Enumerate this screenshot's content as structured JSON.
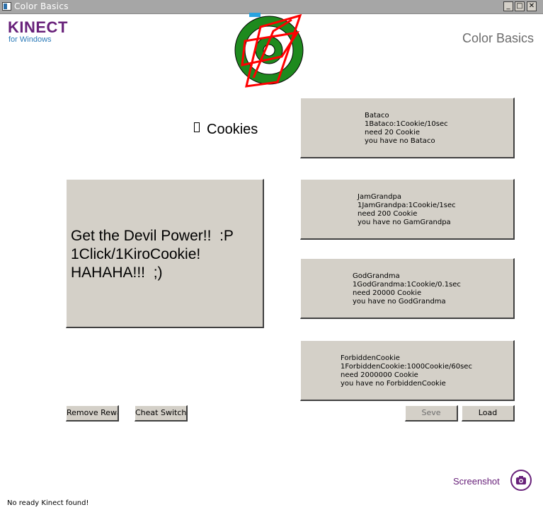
{
  "window": {
    "title": "Color Basics",
    "controls": {
      "minimize": "_",
      "maximize": "□",
      "close": "✕"
    }
  },
  "brand": {
    "line1": "KINECT",
    "line2": "for Windows"
  },
  "header": {
    "app_title": "Color Basics"
  },
  "counter": {
    "label": "Cookies"
  },
  "main_button": {
    "label": "Get the Devil Power!!  :P\n1Click/1KiroCookie!\nHAHAHA!!!  ;)"
  },
  "upgrades": [
    {
      "label": "Bataco\n1Bataco:1Cookie/10sec\nneed 20 Cookie\nyou have no Bataco"
    },
    {
      "label": "JamGrandpa\n1JamGrandpa:1Cookie/1sec\nneed 200 Cookie\nyou have no GamGrandpa"
    },
    {
      "label": "GodGrandma\n1GodGrandma:1Cookie/0.1sec\nneed 20000 Cookie\nyou have no GodGrandma"
    },
    {
      "label": "ForbiddenCookie\n1ForbiddenCookie:1000Cookie/60sec\nneed 2000000 Cookie\nyou have no ForbiddenCookie"
    }
  ],
  "toolbar": {
    "remove_label": "Remove Rewa",
    "cheat_label": "Cheat Switch",
    "save_label": "Seve",
    "load_label": "Load"
  },
  "screenshot": {
    "label": "Screenshot"
  },
  "status": {
    "text": "No ready Kinect found!"
  },
  "colors": {
    "brand_purple": "#68217a",
    "brand_blue": "#2a7ab8",
    "button_face": "#d4d0c8",
    "target_green": "#1e8a1e",
    "scribble_red": "#ff0000"
  },
  "icons": {
    "target": "target-with-red-scribble",
    "camera": "camera-icon"
  }
}
